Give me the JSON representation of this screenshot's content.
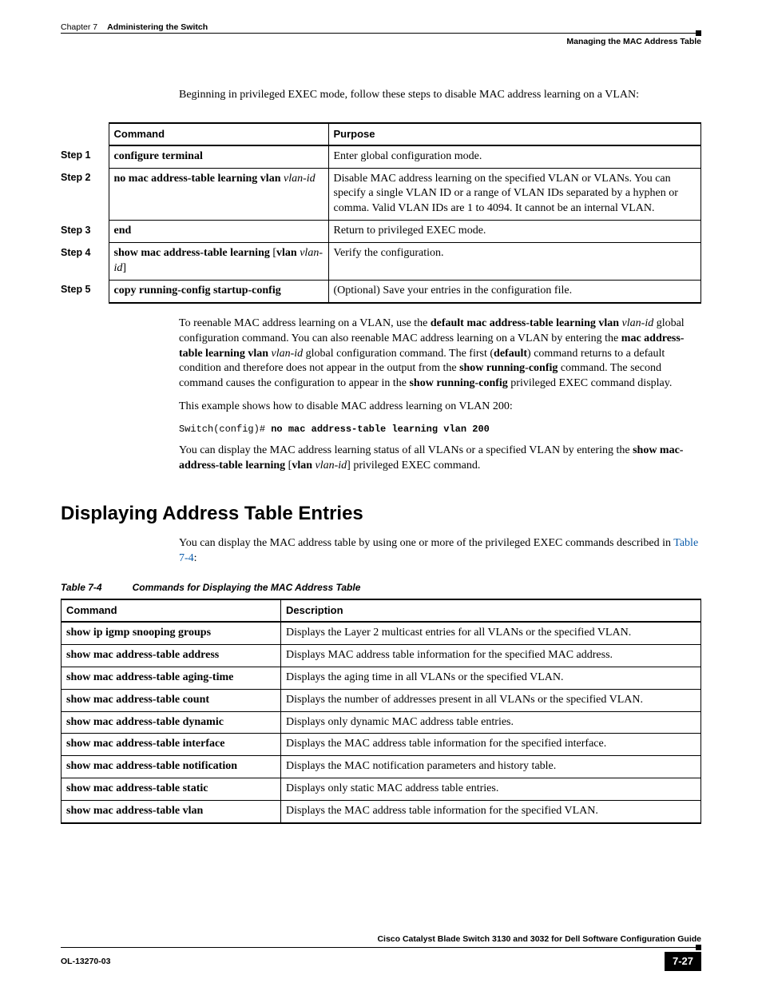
{
  "header": {
    "chapter": "Chapter 7",
    "title": "Administering the Switch",
    "section": "Managing the MAC Address Table"
  },
  "intro": "Beginning in privileged EXEC mode, follow these steps to disable MAC address learning on a VLAN:",
  "steps_headers": {
    "command": "Command",
    "purpose": "Purpose"
  },
  "steps": [
    {
      "label": "Step 1",
      "cmd": "configure terminal",
      "arg": "",
      "purpose": "Enter global configuration mode."
    },
    {
      "label": "Step 2",
      "cmd": "no mac address-table learning vlan",
      "arg": "vlan-id",
      "purpose": "Disable MAC address learning on the specified VLAN or VLANs. You can specify a single VLAN ID or a range of VLAN IDs separated by a hyphen or comma. Valid VLAN IDs are 1 to 4094. It cannot be an internal VLAN."
    },
    {
      "label": "Step 3",
      "cmd": "end",
      "arg": "",
      "purpose": "Return to privileged EXEC mode."
    },
    {
      "label": "Step 4",
      "cmd_pre": "show mac address-table learning",
      "br_open": " [",
      "cmd_bold2": "vlan",
      "arg": " vlan-id",
      "br_close": "]",
      "purpose": "Verify the configuration."
    },
    {
      "label": "Step 5",
      "cmd": "copy running-config startup-config",
      "arg": "",
      "purpose": "(Optional) Save your entries in the configuration file."
    }
  ],
  "p_reenable": {
    "t1": "To reenable MAC address learning on a VLAN, use the ",
    "b1": "default mac address-table learning vlan",
    "t2": " ",
    "i1": "vlan-id",
    "t3": " global configuration command. You can also reenable MAC address learning on a VLAN by entering the ",
    "b2": "mac address-table learning vlan",
    "t4": " ",
    "i2": "vlan-id",
    "t5": " global configuration command. The first (",
    "b3": "default",
    "t6": ") command returns to a default condition and therefore does not appear in the output from the ",
    "b4": "show running-config",
    "t7": " command. The second command causes the configuration to appear in the ",
    "b5": "show running-config",
    "t8": " privileged EXEC command display."
  },
  "p_example_intro": "This example shows how to disable MAC address learning on VLAN 200:",
  "cli": {
    "prompt": "Switch(config)# ",
    "cmd": "no mac address-table learning vlan 200"
  },
  "p_display": {
    "t1": "You can display the MAC address learning status of all VLANs or a specified VLAN by entering the ",
    "b1": "show mac-address-table learning",
    "t2": " [",
    "b2": "vlan",
    "t3": " ",
    "i1": "vlan-id",
    "t4": "] privileged EXEC command."
  },
  "section_heading": "Displaying Address Table Entries",
  "section_intro": {
    "t1": "You can display the MAC address table by using one or more of the privileged EXEC commands described in ",
    "link": "Table 7-4",
    "t2": ":"
  },
  "table74": {
    "caption_num": "Table 7-4",
    "caption_title": "Commands for Displaying the MAC Address Table",
    "headers": {
      "command": "Command",
      "description": "Description"
    },
    "rows": [
      {
        "cmd": "show ip igmp snooping groups",
        "desc": "Displays the Layer 2 multicast entries for all VLANs or the specified VLAN."
      },
      {
        "cmd": "show mac address-table address",
        "desc": "Displays MAC address table information for the specified MAC address."
      },
      {
        "cmd": "show mac address-table aging-time",
        "desc": "Displays the aging time in all VLANs or the specified VLAN."
      },
      {
        "cmd": "show mac address-table count",
        "desc": "Displays the number of addresses present in all VLANs or the specified VLAN."
      },
      {
        "cmd": "show mac address-table dynamic",
        "desc": "Displays only dynamic MAC address table entries."
      },
      {
        "cmd": "show mac address-table interface",
        "desc": "Displays the MAC address table information for the specified interface."
      },
      {
        "cmd": "show mac address-table notification",
        "desc": "Displays the MAC notification parameters and history table."
      },
      {
        "cmd": "show mac address-table static",
        "desc": "Displays only static MAC address table entries."
      },
      {
        "cmd": "show mac address-table vlan",
        "desc": "Displays the MAC address table information for the specified VLAN."
      }
    ]
  },
  "footer": {
    "guide": "Cisco Catalyst Blade Switch 3130 and 3032 for Dell Software Configuration Guide",
    "docid": "OL-13270-03",
    "pagenum": "7-27"
  }
}
